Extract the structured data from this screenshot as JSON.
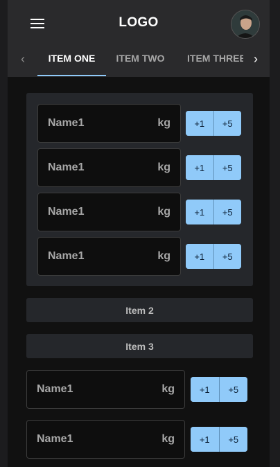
{
  "header": {
    "logo": "LOGO",
    "menu_icon": "hamburger-menu-icon",
    "avatar_icon": "user-avatar"
  },
  "tabs": {
    "items": [
      {
        "label": "ITEM ONE",
        "active": true
      },
      {
        "label": "ITEM TWO",
        "active": false
      },
      {
        "label": "ITEM THREE",
        "active": false
      }
    ],
    "prev_icon": "chevron-left-icon",
    "next_icon": "chevron-right-icon"
  },
  "panel": {
    "rows": [
      {
        "name": "Name1",
        "unit": "kg",
        "plus1": "+1",
        "plus5": "+5"
      },
      {
        "name": "Name1",
        "unit": "kg",
        "plus1": "+1",
        "plus5": "+5"
      },
      {
        "name": "Name1",
        "unit": "kg",
        "plus1": "+1",
        "plus5": "+5"
      },
      {
        "name": "Name1",
        "unit": "kg",
        "plus1": "+1",
        "plus5": "+5"
      }
    ]
  },
  "sections": [
    {
      "label": "Item 2"
    },
    {
      "label": "Item 3"
    }
  ],
  "loose_rows": [
    {
      "name": "Name1",
      "unit": "kg",
      "plus1": "+1",
      "plus5": "+5"
    },
    {
      "name": "Name1",
      "unit": "kg",
      "plus1": "+1",
      "plus5": "+5"
    }
  ],
  "colors": {
    "accent": "#90caf9",
    "appbar": "#2a2a2c",
    "panel": "#25272b",
    "background": "#111111"
  }
}
